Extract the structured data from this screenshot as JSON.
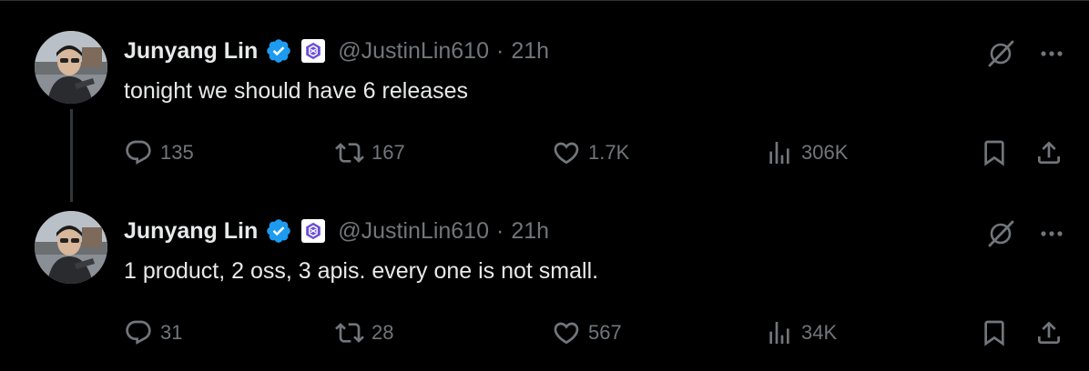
{
  "colors": {
    "background": "#000000",
    "text_primary": "#e7e9ea",
    "text_secondary": "#71767b",
    "verified_blue": "#1d9bf0",
    "divider": "#2f3336"
  },
  "tweets": [
    {
      "author": {
        "name": "Junyang Lin",
        "handle": "@JustinLin610",
        "verified": true,
        "affiliate_badge": "qwen-logo-icon"
      },
      "separator": "·",
      "time": "21h",
      "text": "tonight we should have 6 releases",
      "stats": {
        "replies": "135",
        "reposts": "167",
        "likes": "1.7K",
        "views": "306K"
      }
    },
    {
      "author": {
        "name": "Junyang Lin",
        "handle": "@JustinLin610",
        "verified": true,
        "affiliate_badge": "qwen-logo-icon"
      },
      "separator": "·",
      "time": "21h",
      "text": "1 product, 2 oss, 3 apis. every one is not small.",
      "stats": {
        "replies": "31",
        "reposts": "28",
        "likes": "567",
        "views": "34K"
      }
    }
  ]
}
